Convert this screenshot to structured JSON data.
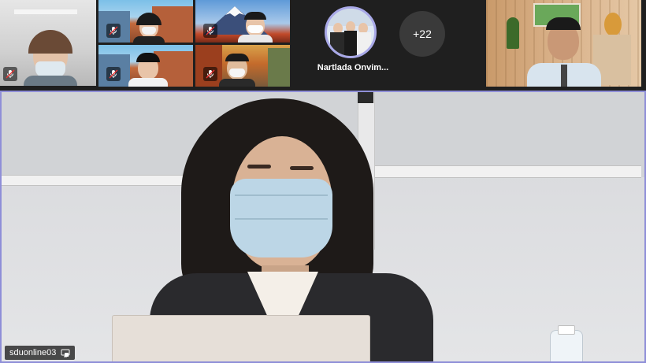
{
  "participants": {
    "spotlight_name": "Nartlada Onvim...",
    "overflow_count": "+22"
  },
  "main_speaker": {
    "label": "sduonline03"
  },
  "colors": {
    "background": "#1f1f1f",
    "active_border": "#8f8fd8",
    "mask": "#cfe3ee"
  },
  "icons": {
    "mic_muted": "mic-muted-icon",
    "screen_share": "share-screen-icon"
  }
}
